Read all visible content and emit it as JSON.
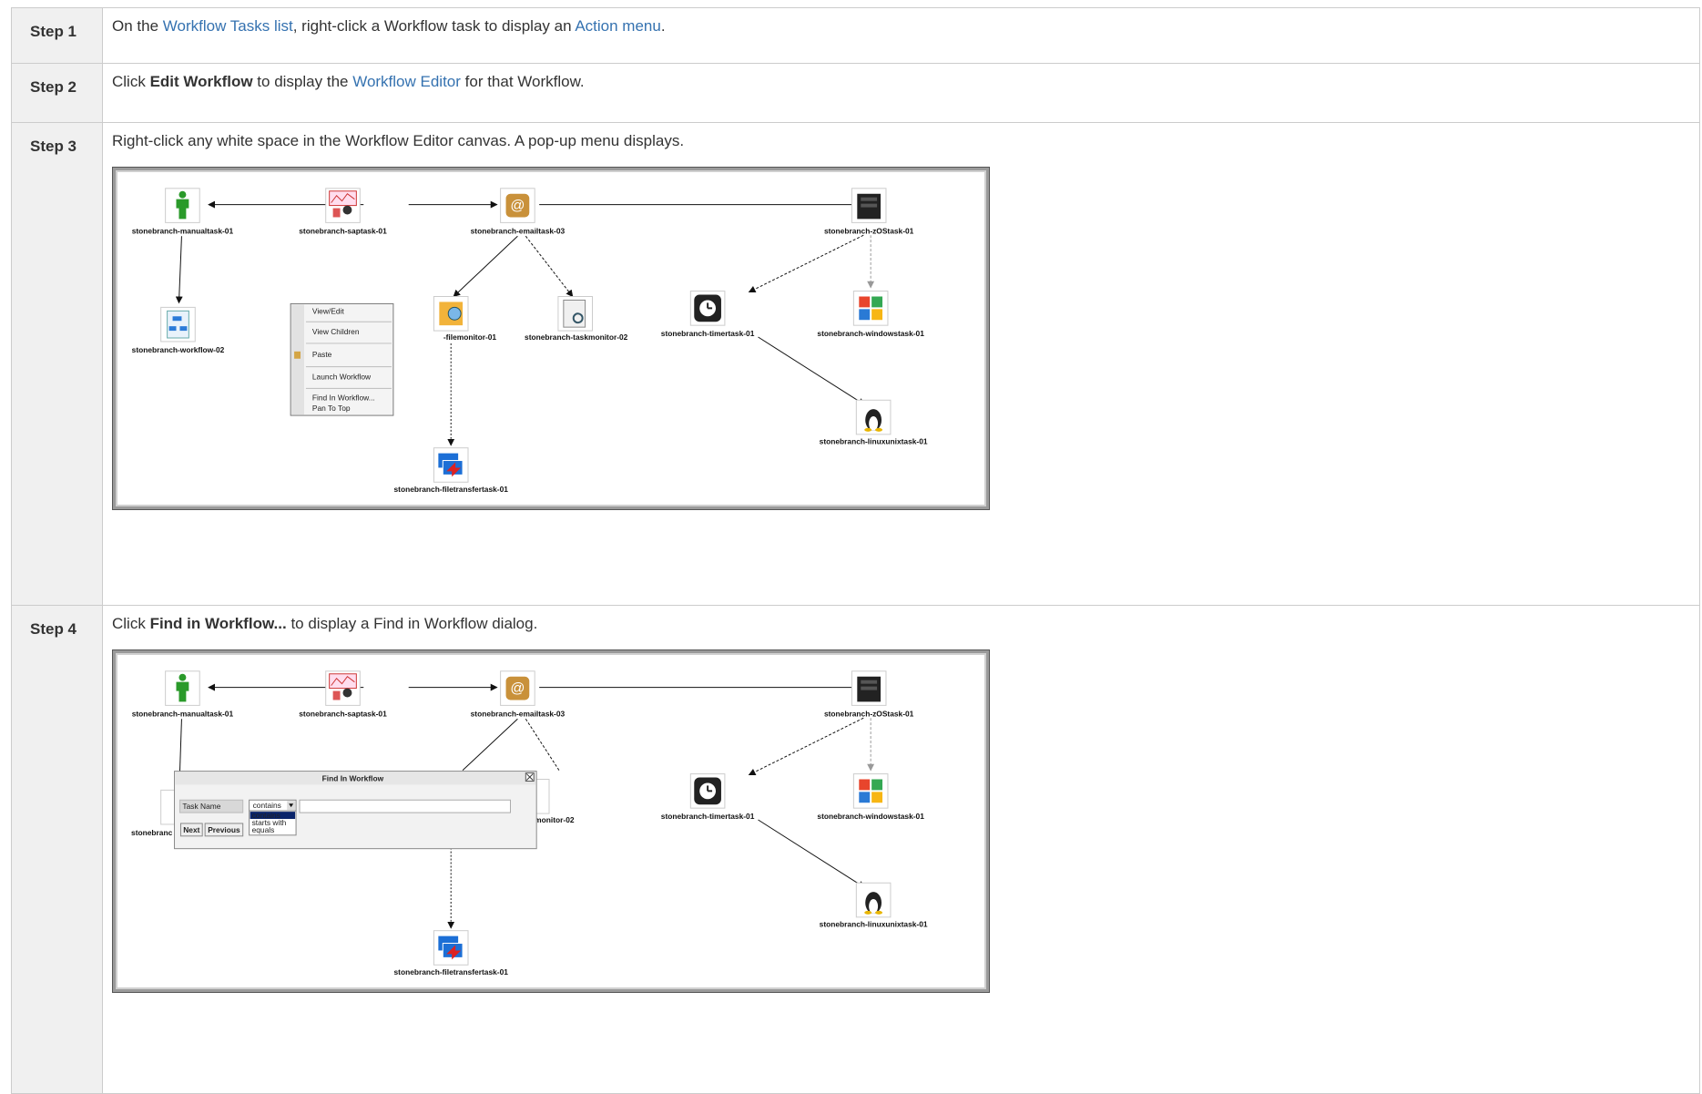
{
  "steps": [
    {
      "label": "Step 1",
      "pre": "On the ",
      "link1": "Workflow Tasks list",
      "mid": ", right-click a Workflow task to display an ",
      "link2": "Action menu",
      "post": "."
    },
    {
      "label": "Step 2",
      "pre": "Click ",
      "bold": "Edit Workflow",
      "mid": " to display the ",
      "link": "Workflow Editor",
      "post": " for that Workflow."
    },
    {
      "label": "Step 3",
      "text": "Right-click any white space in the Workflow Editor canvas. A pop-up menu displays."
    },
    {
      "label": "Step 4",
      "pre": "Click ",
      "bold": "Find in Workflow...",
      "post": " to display a Find in Workflow dialog."
    }
  ],
  "workflow": {
    "manual": "stonebranch-manualtask-01",
    "sap": "stonebranch-saptask-01",
    "email": "stonebranch-emailtask-03",
    "zos": "stonebranch-zOStask-01",
    "workflow": "stonebranch-workflow-02",
    "filemonitor_partial": "-filemonitor-01",
    "taskmonitor": "stonebranch-taskmonitor-02",
    "taskmonitor_partial": "monitor-02",
    "workflow_partial": "stonebranc",
    "timer": "stonebranch-timertask-01",
    "windows": "stonebranch-windowstask-01",
    "linux": "stonebranch-linuxunixtask-01",
    "filetransfer": "stonebranch-filetransfertask-01"
  },
  "context_menu": {
    "items": [
      "View/Edit",
      "View Children",
      "Paste",
      "Launch Workflow",
      "Find In Workflow...",
      "Pan To Top"
    ]
  },
  "find_dialog": {
    "title": "Find In Workflow",
    "field_label": "Task Name",
    "selected": "contains",
    "options": [
      "contains",
      "starts with",
      "equals"
    ],
    "next_label": "Next",
    "previous_label": "Previous"
  },
  "icons": [
    "manual-task-icon",
    "sap-task-icon",
    "email-task-icon",
    "zos-server-icon",
    "workflow-icon",
    "file-monitor-icon",
    "task-monitor-icon",
    "timer-icon",
    "windows-icon",
    "linux-icon",
    "file-transfer-icon"
  ]
}
